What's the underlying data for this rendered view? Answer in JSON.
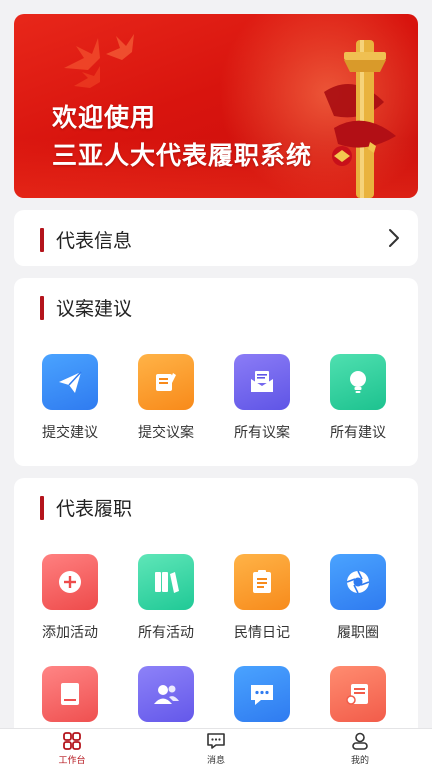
{
  "banner": {
    "line1": "欢迎使用",
    "line2": "三亚人大代表履职系统"
  },
  "rep_info": {
    "title": "代表信息",
    "chevron_icon": "chevron-right-icon"
  },
  "proposals": {
    "title": "议案建议",
    "items": [
      {
        "label": "提交建议",
        "icon": "paper-plane-icon",
        "color_from": "#4aa3ff",
        "color_to": "#2f7bf0"
      },
      {
        "label": "提交议案",
        "icon": "document-edit-icon",
        "color_from": "#ffb347",
        "color_to": "#f88a1a"
      },
      {
        "label": "所有议案",
        "icon": "envelope-icon",
        "color_from": "#8b7cf6",
        "color_to": "#5f55e6"
      },
      {
        "label": "所有建议",
        "icon": "lightbulb-icon",
        "color_from": "#4fe0b0",
        "color_to": "#1dc28f"
      }
    ]
  },
  "duties": {
    "title": "代表履职",
    "items": [
      {
        "label": "添加活动",
        "icon": "plus-circle-icon",
        "color_from": "#ff8080",
        "color_to": "#ee4b4b"
      },
      {
        "label": "所有活动",
        "icon": "books-icon",
        "color_from": "#5fe6b8",
        "color_to": "#20c996"
      },
      {
        "label": "民情日记",
        "icon": "clipboard-icon",
        "color_from": "#ffb347",
        "color_to": "#f78b1c"
      },
      {
        "label": "履职圈",
        "icon": "aperture-icon",
        "color_from": "#4aa3ff",
        "color_to": "#2f7bf0"
      },
      {
        "label": "",
        "icon": "book-icon",
        "color_from": "#ff8585",
        "color_to": "#ef5050"
      },
      {
        "label": "",
        "icon": "contacts-icon",
        "color_from": "#8d82f8",
        "color_to": "#6458ea"
      },
      {
        "label": "",
        "icon": "chat-bubble-icon",
        "color_from": "#4aa3ff",
        "color_to": "#2f7bf0"
      },
      {
        "label": "",
        "icon": "certificate-icon",
        "color_from": "#ff8c70",
        "color_to": "#f25c4a"
      }
    ]
  },
  "tabbar": {
    "items": [
      {
        "label": "工作台",
        "icon": "grid-icon",
        "active": true
      },
      {
        "label": "消息",
        "icon": "message-icon",
        "active": false
      },
      {
        "label": "我的",
        "icon": "user-icon",
        "active": false
      }
    ]
  },
  "colors": {
    "accent": "#b4141c",
    "background": "#f2f2f4"
  }
}
